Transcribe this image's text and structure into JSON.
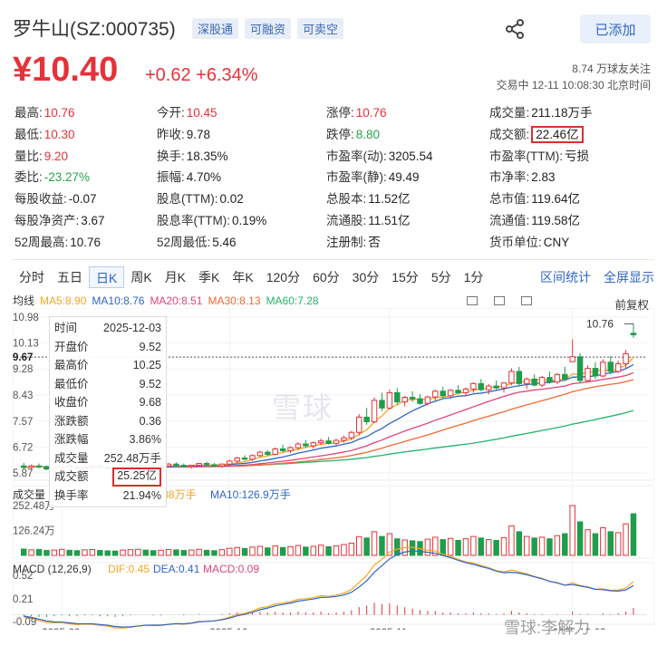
{
  "header": {
    "stock_name": "罗牛山(SZ:000735)",
    "tags": [
      "深股通",
      "可融资",
      "可卖空"
    ],
    "add_button": "已添加"
  },
  "price": {
    "current": "¥10.40",
    "change": "+0.62",
    "change_pct": "+6.34%",
    "followers": "8.74 万球友关注",
    "status_time": "交易中 12-11 10:08:30 北京时间"
  },
  "quote_rows": [
    [
      {
        "k": "最高:",
        "v": "10.76",
        "c": "red"
      },
      {
        "k": "今开:",
        "v": "10.45",
        "c": "red"
      },
      {
        "k": "涨停:",
        "v": "10.76",
        "c": "red"
      },
      {
        "k": "成交量:",
        "v": "211.18万手",
        "c": "dark"
      }
    ],
    [
      {
        "k": "最低:",
        "v": "10.30",
        "c": "red"
      },
      {
        "k": "昨收:",
        "v": "9.78",
        "c": "dark"
      },
      {
        "k": "跌停:",
        "v": "8.80",
        "c": "green"
      },
      {
        "k": "成交额:",
        "v": "22.46亿",
        "c": "dark",
        "box": true
      }
    ],
    [
      {
        "k": "量比:",
        "v": "9.20",
        "c": "red"
      },
      {
        "k": "换手:",
        "v": "18.35%",
        "c": "dark"
      },
      {
        "k": "市盈率(动):",
        "v": "3205.54",
        "c": "dark"
      },
      {
        "k": "市盈率(TTM):",
        "v": "亏损",
        "c": "dark"
      }
    ],
    [
      {
        "k": "委比:",
        "v": "-23.27%",
        "c": "green"
      },
      {
        "k": "振幅:",
        "v": "4.70%",
        "c": "dark"
      },
      {
        "k": "市盈率(静):",
        "v": "49.49",
        "c": "dark"
      },
      {
        "k": "市净率:",
        "v": "2.83",
        "c": "dark"
      }
    ],
    [
      {
        "k": "每股收益:",
        "v": "-0.07",
        "c": "dark"
      },
      {
        "k": "股息(TTM):",
        "v": "0.02",
        "c": "dark"
      },
      {
        "k": "总股本:",
        "v": "11.52亿",
        "c": "dark"
      },
      {
        "k": "总市值:",
        "v": "119.64亿",
        "c": "dark"
      }
    ],
    [
      {
        "k": "每股净资产:",
        "v": "3.67",
        "c": "dark"
      },
      {
        "k": "股息率(TTM):",
        "v": "0.19%",
        "c": "dark"
      },
      {
        "k": "流通股:",
        "v": "11.51亿",
        "c": "dark"
      },
      {
        "k": "流通值:",
        "v": "119.58亿",
        "c": "dark"
      }
    ],
    [
      {
        "k": "52周最高:",
        "v": "10.76",
        "c": "dark"
      },
      {
        "k": "52周最低:",
        "v": "5.46",
        "c": "dark"
      },
      {
        "k": "注册制:",
        "v": "否",
        "c": "dark"
      },
      {
        "k": "货币单位:",
        "v": "CNY",
        "c": "dark"
      }
    ]
  ],
  "period_tabs": [
    "分时",
    "五日",
    "日K",
    "周K",
    "月K",
    "季K",
    "年K",
    "120分",
    "60分",
    "30分",
    "15分",
    "5分",
    "1分"
  ],
  "active_tab": "日K",
  "right_links": [
    "区间统计",
    "全屏显示"
  ],
  "ma_legend": [
    {
      "label": "均线",
      "color": "#333333"
    },
    {
      "label": "MA5:8.90",
      "color": "#f5a623"
    },
    {
      "label": "MA10:8.76",
      "color": "#2f66c5"
    },
    {
      "label": "MA20:8.51",
      "color": "#e0457b"
    },
    {
      "label": "MA30:8.13",
      "color": "#f06a35"
    },
    {
      "label": "MA60:7.28",
      "color": "#27b36b"
    }
  ],
  "fuquan": "前复权",
  "tooltip": [
    {
      "k": "时间",
      "v": "2025-12-03",
      "c": "dark"
    },
    {
      "k": "开盘价",
      "v": "9.52",
      "c": "red"
    },
    {
      "k": "最高价",
      "v": "10.25",
      "c": "red"
    },
    {
      "k": "最低价",
      "v": "9.52",
      "c": "red"
    },
    {
      "k": "收盘价",
      "v": "9.68",
      "c": "red"
    },
    {
      "k": "涨跌额",
      "v": "0.36",
      "c": "red"
    },
    {
      "k": "涨跌幅",
      "v": "3.86%",
      "c": "red"
    },
    {
      "k": "成交量",
      "v": "252.48万手",
      "c": "dark"
    },
    {
      "k": "成交额",
      "v": "25.25亿",
      "c": "dark",
      "box": true
    },
    {
      "k": "换手率",
      "v": "21.94%",
      "c": "dark"
    }
  ],
  "watermark": "雪球",
  "watermark_user": "雪球:李解力",
  "chart_data": {
    "type": "candlestick",
    "price_axis_labels": [
      "10.98",
      "10.13",
      "9.67",
      "9.28",
      "8.43",
      "7.57",
      "6.72",
      "5.87"
    ],
    "price_axis_values": [
      10.98,
      10.13,
      9.67,
      9.28,
      8.43,
      7.57,
      6.72,
      5.87
    ],
    "crosshair_price": 9.67,
    "max_label": "10.76",
    "volume_legend": {
      "label": "成交量",
      "ma5": ".88万手",
      "ma10": "MA10:126.9万手"
    },
    "volume_axis_labels": [
      "252.48万",
      "126.24万"
    ],
    "volume_axis_values": [
      252.48,
      126.24
    ],
    "macd_legend": [
      {
        "label": "MACD (12,26,9)",
        "color": "#333333"
      },
      {
        "label": "DIF:0.45",
        "color": "#f5a623"
      },
      {
        "label": "DEA:0.41",
        "color": "#2f66c5"
      },
      {
        "label": "MACD:0.09",
        "color": "#e0457b"
      }
    ],
    "macd_axis_labels": [
      "0.52",
      "0.21",
      "-0.09"
    ],
    "macd_axis_values": [
      0.52,
      0.21,
      -0.09
    ],
    "date_labels": [
      {
        "label": "2025-09",
        "idx": 5
      },
      {
        "label": "2025-10",
        "idx": 27
      },
      {
        "label": "2025-11",
        "idx": 48
      },
      {
        "label": "2025-12-03",
        "idx": 72
      }
    ],
    "candles": [
      [
        6.1,
        6.2,
        6.0,
        6.05
      ],
      [
        6.05,
        6.15,
        5.98,
        6.1
      ],
      [
        6.1,
        6.18,
        6.02,
        6.08
      ],
      [
        6.08,
        6.12,
        5.96,
        6.0
      ],
      [
        6.0,
        6.08,
        5.92,
        6.04
      ],
      [
        6.04,
        6.15,
        6.0,
        6.12
      ],
      [
        6.12,
        6.2,
        6.05,
        6.08
      ],
      [
        6.08,
        6.12,
        5.98,
        6.02
      ],
      [
        6.02,
        6.1,
        5.96,
        6.06
      ],
      [
        6.06,
        6.14,
        6.0,
        6.1
      ],
      [
        6.1,
        6.15,
        6.02,
        6.05
      ],
      [
        6.05,
        6.08,
        5.95,
        6.0
      ],
      [
        6.0,
        6.06,
        5.92,
        5.98
      ],
      [
        5.98,
        6.04,
        5.9,
        6.02
      ],
      [
        6.02,
        6.1,
        5.98,
        6.08
      ],
      [
        6.08,
        6.16,
        6.04,
        6.12
      ],
      [
        6.12,
        6.18,
        6.06,
        6.1
      ],
      [
        6.1,
        6.14,
        6.02,
        6.06
      ],
      [
        6.06,
        6.12,
        6.0,
        6.1
      ],
      [
        6.1,
        6.2,
        6.06,
        6.16
      ],
      [
        6.16,
        6.22,
        6.08,
        6.12
      ],
      [
        6.12,
        6.18,
        6.04,
        6.08
      ],
      [
        6.08,
        6.14,
        6.02,
        6.12
      ],
      [
        6.12,
        6.2,
        6.08,
        6.18
      ],
      [
        6.18,
        6.24,
        6.1,
        6.14
      ],
      [
        6.14,
        6.2,
        6.06,
        6.1
      ],
      [
        6.1,
        6.18,
        6.04,
        6.16
      ],
      [
        6.16,
        6.3,
        6.12,
        6.26
      ],
      [
        6.26,
        6.4,
        6.2,
        6.36
      ],
      [
        6.36,
        6.45,
        6.28,
        6.32
      ],
      [
        6.32,
        6.48,
        6.26,
        6.44
      ],
      [
        6.44,
        6.6,
        6.38,
        6.55
      ],
      [
        6.55,
        6.62,
        6.42,
        6.48
      ],
      [
        6.48,
        6.7,
        6.44,
        6.66
      ],
      [
        6.66,
        6.8,
        6.55,
        6.6
      ],
      [
        6.6,
        6.75,
        6.52,
        6.7
      ],
      [
        6.7,
        6.88,
        6.62,
        6.82
      ],
      [
        6.82,
        6.95,
        6.7,
        6.76
      ],
      [
        6.76,
        6.9,
        6.66,
        6.86
      ],
      [
        6.86,
        7.0,
        6.78,
        6.92
      ],
      [
        6.92,
        7.05,
        6.8,
        6.84
      ],
      [
        6.84,
        6.98,
        6.76,
        6.94
      ],
      [
        6.94,
        7.1,
        6.86,
        7.02
      ],
      [
        7.02,
        7.25,
        6.95,
        7.2
      ],
      [
        7.2,
        7.8,
        7.1,
        7.7
      ],
      [
        7.7,
        8.0,
        7.45,
        7.55
      ],
      [
        7.55,
        8.35,
        7.5,
        8.25
      ],
      [
        8.25,
        8.5,
        7.9,
        8.0
      ],
      [
        8.0,
        8.6,
        7.95,
        8.5
      ],
      [
        8.5,
        8.65,
        8.1,
        8.2
      ],
      [
        8.2,
        8.4,
        8.05,
        8.35
      ],
      [
        8.35,
        8.55,
        8.2,
        8.3
      ],
      [
        8.3,
        8.45,
        8.1,
        8.15
      ],
      [
        8.15,
        8.4,
        8.08,
        8.36
      ],
      [
        8.36,
        8.6,
        8.25,
        8.55
      ],
      [
        8.55,
        8.7,
        8.35,
        8.4
      ],
      [
        8.4,
        8.62,
        8.3,
        8.58
      ],
      [
        8.58,
        8.75,
        8.45,
        8.5
      ],
      [
        8.5,
        8.68,
        8.38,
        8.62
      ],
      [
        8.62,
        8.85,
        8.5,
        8.8
      ],
      [
        8.8,
        8.95,
        8.55,
        8.6
      ],
      [
        8.6,
        8.78,
        8.45,
        8.72
      ],
      [
        8.72,
        8.9,
        8.6,
        8.66
      ],
      [
        8.66,
        8.85,
        8.5,
        8.82
      ],
      [
        8.82,
        9.3,
        8.75,
        9.2
      ],
      [
        9.2,
        9.35,
        8.7,
        8.8
      ],
      [
        8.8,
        9.0,
        8.62,
        8.95
      ],
      [
        8.95,
        9.1,
        8.7,
        8.75
      ],
      [
        8.75,
        9.05,
        8.68,
        9.0
      ],
      [
        9.0,
        9.2,
        8.8,
        8.85
      ],
      [
        8.85,
        9.15,
        8.78,
        9.1
      ],
      [
        9.1,
        9.35,
        8.9,
        8.95
      ],
      [
        9.52,
        10.25,
        9.52,
        9.68
      ],
      [
        9.68,
        9.8,
        8.8,
        8.9
      ],
      [
        8.9,
        9.4,
        8.85,
        9.3
      ],
      [
        9.3,
        9.5,
        8.95,
        9.05
      ],
      [
        9.05,
        9.6,
        9.0,
        9.5
      ],
      [
        9.5,
        9.7,
        9.1,
        9.2
      ],
      [
        9.2,
        9.55,
        9.15,
        9.45
      ],
      [
        9.45,
        9.9,
        9.3,
        9.78
      ],
      [
        10.45,
        10.76,
        10.3,
        10.4
      ]
    ],
    "volumes": [
      32,
      28,
      30,
      25,
      27,
      31,
      26,
      24,
      28,
      30,
      25,
      23,
      22,
      27,
      29,
      31,
      27,
      24,
      26,
      30,
      28,
      25,
      27,
      31,
      26,
      24,
      29,
      36,
      40,
      35,
      42,
      46,
      38,
      48,
      40,
      44,
      50,
      42,
      46,
      52,
      44,
      48,
      55,
      62,
      95,
      88,
      120,
      96,
      110,
      84,
      78,
      74,
      70,
      82,
      92,
      80,
      86,
      76,
      84,
      96,
      88,
      80,
      76,
      90,
      150,
      120,
      96,
      88,
      92,
      84,
      100,
      110,
      252.48,
      170,
      130,
      110,
      140,
      120,
      115,
      160,
      211.18
    ],
    "macd_hist": [
      -0.02,
      -0.02,
      -0.03,
      -0.03,
      -0.02,
      -0.01,
      -0.02,
      -0.02,
      -0.01,
      -0.01,
      -0.02,
      -0.02,
      -0.03,
      -0.02,
      -0.01,
      0.0,
      0.0,
      -0.01,
      -0.01,
      0.0,
      0.0,
      -0.01,
      0.0,
      0.01,
      0.0,
      0.0,
      0.01,
      0.02,
      0.03,
      0.02,
      0.03,
      0.04,
      0.03,
      0.04,
      0.03,
      0.03,
      0.04,
      0.03,
      0.03,
      0.04,
      0.02,
      0.03,
      0.04,
      0.06,
      0.1,
      0.12,
      0.16,
      0.14,
      0.15,
      0.12,
      0.1,
      0.08,
      0.06,
      0.05,
      0.05,
      0.03,
      0.03,
      0.02,
      0.02,
      0.03,
      0.02,
      0.02,
      0.01,
      0.02,
      0.05,
      0.03,
      0.02,
      0.01,
      0.01,
      0.0,
      0.01,
      0.0,
      0.04,
      0.01,
      0.01,
      0.0,
      0.02,
      0.01,
      0.02,
      0.04,
      0.09
    ]
  }
}
